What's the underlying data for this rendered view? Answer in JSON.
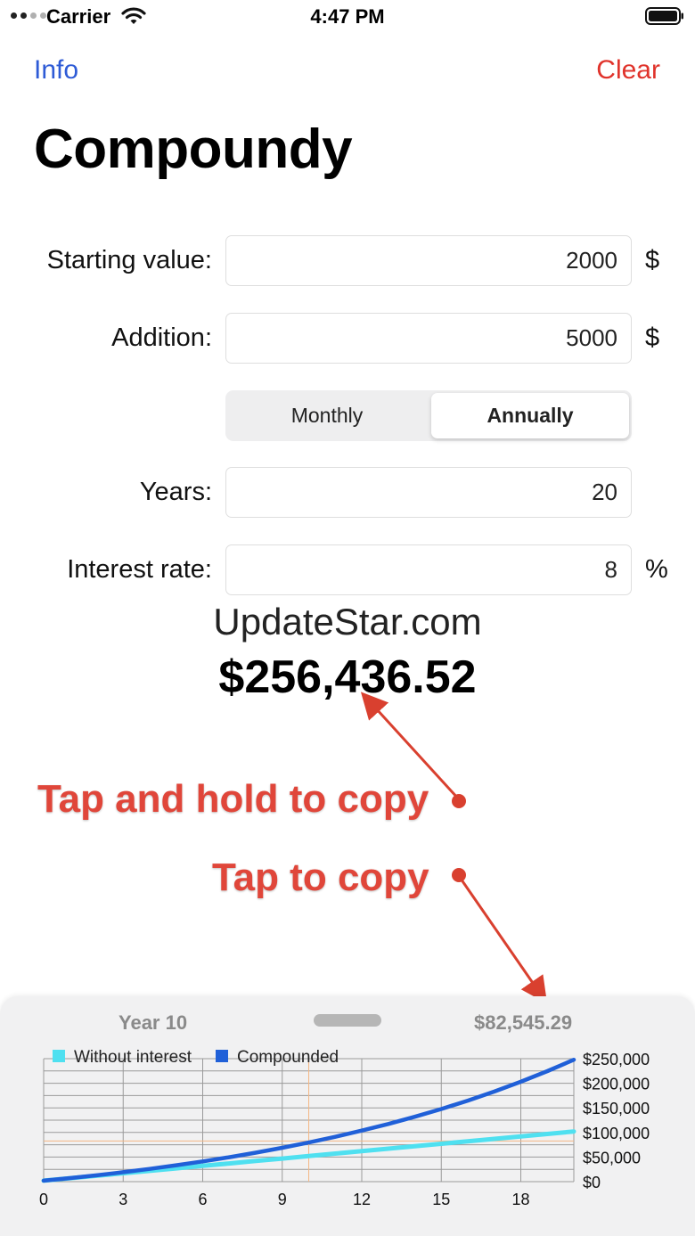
{
  "status_bar": {
    "carrier": "Carrier",
    "time": "4:47 PM"
  },
  "nav": {
    "info_label": "Info",
    "clear_label": "Clear"
  },
  "title": "Compoundy",
  "form": {
    "starting_value": {
      "label": "Starting value:",
      "value": "2000",
      "unit": "$"
    },
    "addition": {
      "label": "Addition:",
      "value": "5000",
      "unit": "$"
    },
    "frequency": {
      "options": [
        "Monthly",
        "Annually"
      ],
      "selected": "Annually"
    },
    "years": {
      "label": "Years:",
      "value": "20"
    },
    "interest_rate": {
      "label": "Interest rate:",
      "value": "8",
      "unit": "%"
    }
  },
  "watermark": "UpdateStar.com",
  "result": "$256,436.52",
  "annotations": {
    "hold_to_copy": "Tap and hold to copy",
    "tap_to_copy": "Tap to copy"
  },
  "sheet": {
    "year_label": "Year 10",
    "value_label": "$82,545.29"
  },
  "colors": {
    "accent_blue": "#2e5bd6",
    "clear_red": "#e0332b",
    "annotation_red": "#e0463a",
    "without_interest": "#4fe0f0",
    "compounded": "#2060d8"
  },
  "chart_data": {
    "type": "line",
    "legend": [
      "Without interest",
      "Compounded"
    ],
    "legend_position": "top-left",
    "x": [
      0,
      1,
      2,
      3,
      4,
      5,
      6,
      7,
      8,
      9,
      10,
      11,
      12,
      13,
      14,
      15,
      16,
      17,
      18,
      19,
      20
    ],
    "xticks": [
      0,
      3,
      6,
      9,
      12,
      15,
      18
    ],
    "xlim": [
      0,
      20
    ],
    "ylim": [
      0,
      250000
    ],
    "yticks": [
      "$0",
      "$50,000",
      "$100,000",
      "$150,000",
      "$200,000",
      "$250,000"
    ],
    "ytick_values": [
      0,
      50000,
      100000,
      150000,
      200000,
      250000
    ],
    "y_axis_side": "right",
    "grid": true,
    "selected_x": 10,
    "selected_y": 82545.29,
    "series": [
      {
        "name": "Without interest",
        "color": "#4fe0f0",
        "values": [
          2000,
          7000,
          12000,
          17000,
          22000,
          27000,
          32000,
          37000,
          42000,
          47000,
          52000,
          57000,
          62000,
          67000,
          72000,
          77000,
          82000,
          87000,
          92000,
          97000,
          102000
        ]
      },
      {
        "name": "Compounded",
        "color": "#2060d8",
        "values": [
          2000,
          7160,
          12893,
          19164,
          25937,
          33252,
          41152,
          49684,
          58899,
          68851,
          79599,
          91207,
          103744,
          117283,
          131906,
          147698,
          164754,
          183174,
          203068,
          224553,
          247757
        ]
      }
    ]
  }
}
